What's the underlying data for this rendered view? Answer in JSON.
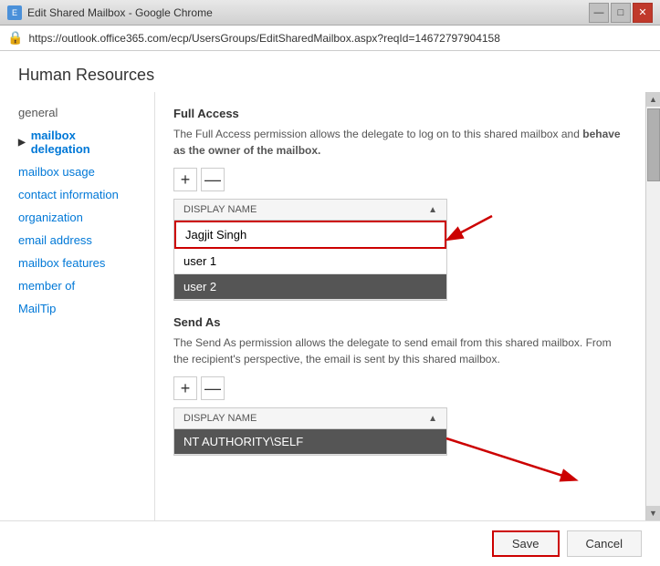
{
  "titleBar": {
    "icon": "E",
    "title": "Edit Shared Mailbox - Google Chrome",
    "controls": {
      "minimize": "—",
      "maximize": "□",
      "close": "✕"
    }
  },
  "addressBar": {
    "url": "https://outlook.office365.com/ecp/UsersGroups/EditSharedMailbox.aspx?reqId=14672797904158"
  },
  "pageTitle": "Human Resources",
  "sidebar": {
    "items": [
      {
        "id": "general",
        "label": "general",
        "active": false,
        "plain": true,
        "arrow": false
      },
      {
        "id": "mailbox-delegation",
        "label": "mailbox delegation",
        "active": true,
        "plain": false,
        "arrow": true
      },
      {
        "id": "mailbox-usage",
        "label": "mailbox usage",
        "active": false,
        "plain": false,
        "arrow": false
      },
      {
        "id": "contact-information",
        "label": "contact information",
        "active": false,
        "plain": false,
        "arrow": false
      },
      {
        "id": "organization",
        "label": "organization",
        "active": false,
        "plain": false,
        "arrow": false
      },
      {
        "id": "email-address",
        "label": "email address",
        "active": false,
        "plain": false,
        "arrow": false
      },
      {
        "id": "mailbox-features",
        "label": "mailbox features",
        "active": false,
        "plain": false,
        "arrow": false
      },
      {
        "id": "member-of",
        "label": "member of",
        "active": false,
        "plain": false,
        "arrow": false
      },
      {
        "id": "mailtip",
        "label": "MailTip",
        "active": false,
        "plain": false,
        "arrow": false
      }
    ]
  },
  "fullAccess": {
    "title": "Full Access",
    "description": "The Full Access permission allows the delegate to log on to this shared mailbox and behave as the owner of the mailbox.",
    "addBtn": "+",
    "removeBtn": "—",
    "columnHeader": "DISPLAY NAME",
    "rows": [
      {
        "label": "Jagjit Singh",
        "highlighted": true,
        "selected": false
      },
      {
        "label": "user 1",
        "highlighted": false,
        "selected": false
      },
      {
        "label": "user 2",
        "highlighted": false,
        "selected": true
      }
    ]
  },
  "sendAs": {
    "title": "Send As",
    "description": "The Send As permission allows the delegate to send email from this shared mailbox. From the recipient's perspective, the email is sent by this shared mailbox.",
    "addBtn": "+",
    "removeBtn": "—",
    "columnHeader": "DISPLAY NAME",
    "rows": [
      {
        "label": "NT AUTHORITY\\SELF",
        "highlighted": false,
        "selected": true
      }
    ]
  },
  "actions": {
    "save": "Save",
    "cancel": "Cancel"
  }
}
